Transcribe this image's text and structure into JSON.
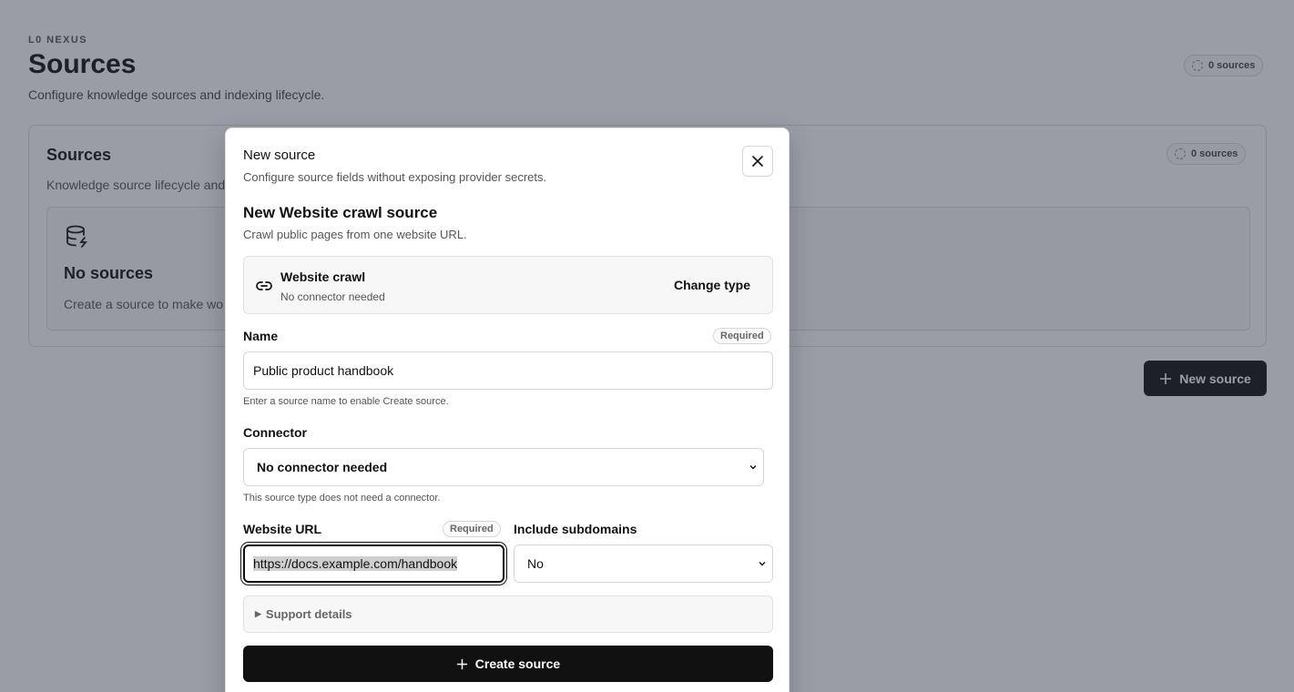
{
  "page": {
    "eyebrow": "L0 NEXUS",
    "title": "Sources",
    "subtitle": "Configure knowledge sources and indexing lifecycle.",
    "count_label": "0 sources"
  },
  "panel": {
    "title": "Sources",
    "subtitle": "Knowledge source lifecycle and",
    "count_label": "0 sources",
    "empty_title": "No sources",
    "empty_subtitle": "Create a source to make wo",
    "new_source_label": "New source"
  },
  "modal": {
    "title": "New source",
    "subtitle": "Configure source fields without exposing provider secrets.",
    "section_title": "New Website crawl source",
    "section_subtitle": "Crawl public pages from one website URL.",
    "type_card": {
      "name": "Website crawl",
      "description": "No connector needed",
      "change_label": "Change type"
    },
    "name_field": {
      "label": "Name",
      "badge": "Required",
      "value": "Public product handbook",
      "hint": "Enter a source name to enable Create source."
    },
    "connector_field": {
      "label": "Connector",
      "value": "No connector needed",
      "hint": "This source type does not need a connector."
    },
    "url_field": {
      "label": "Website URL",
      "badge": "Required",
      "value": "https://docs.example.com/handbook"
    },
    "subdomains_field": {
      "label": "Include subdomains",
      "value": "No"
    },
    "details_label": "Support details",
    "create_label": "Create source"
  }
}
